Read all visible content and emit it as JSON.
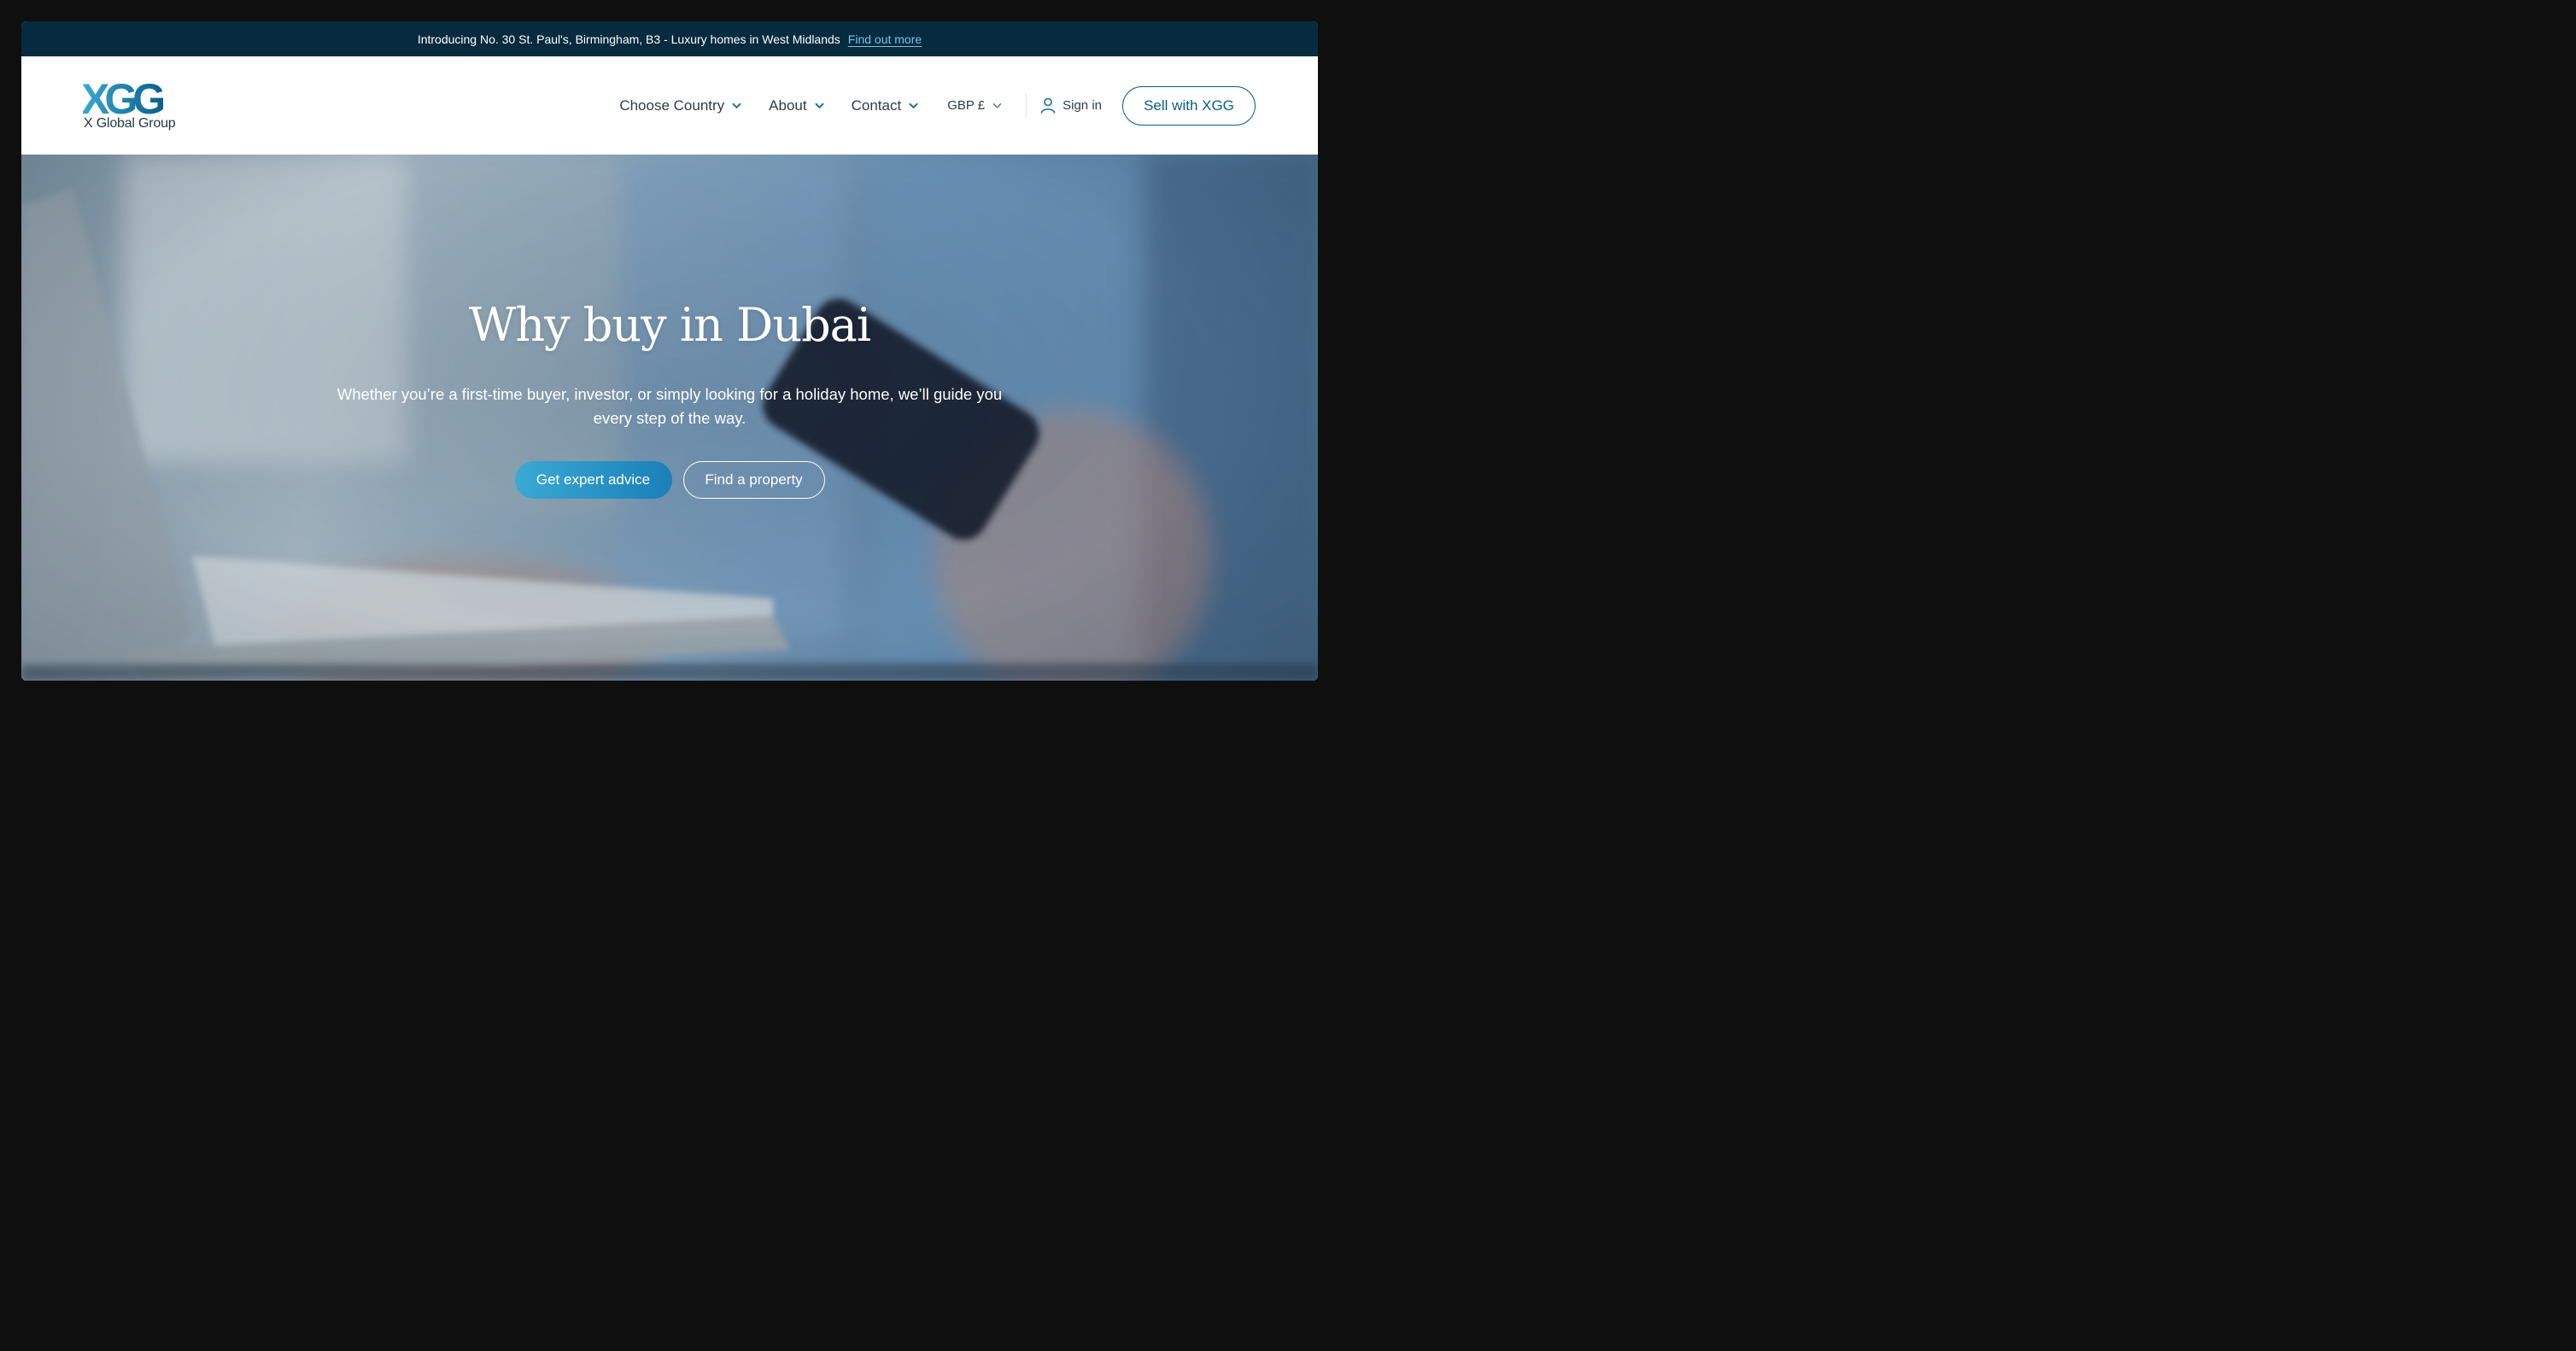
{
  "announcement": {
    "text": "Introducing No. 30 St. Paul's, Birmingham, B3 - Luxury homes in West Midlands",
    "link_label": "Find out more"
  },
  "header": {
    "logo_mark": "XGG",
    "logo_subtitle": "X Global Group",
    "nav": [
      {
        "label": "Choose Country",
        "icon": "chevron-down-icon"
      },
      {
        "label": "About",
        "icon": "chevron-down-icon"
      },
      {
        "label": "Contact",
        "icon": "chevron-down-icon"
      },
      {
        "label": "GBP £",
        "icon": "chevron-down-icon"
      }
    ],
    "signin_label": "Sign in",
    "signin_icon": "user-icon",
    "sell_button_label": "Sell with XGG"
  },
  "hero": {
    "title": "Why buy in Dubai",
    "subtitle": "Whether you’re a first-time buyer, investor, or simply looking for a holiday home, we’ll guide you every step of the way.",
    "primary_button_label": "Get expert advice",
    "secondary_button_label": "Find a property"
  },
  "colors": {
    "announcement_bg": "#062a3e",
    "link": "#7cc3ea",
    "brand_blue": "#0b5f8a",
    "logo_light": "#3aa9d4",
    "primary_gradient_start": "#3aa9d4",
    "primary_gradient_end": "#1a7fb8"
  }
}
